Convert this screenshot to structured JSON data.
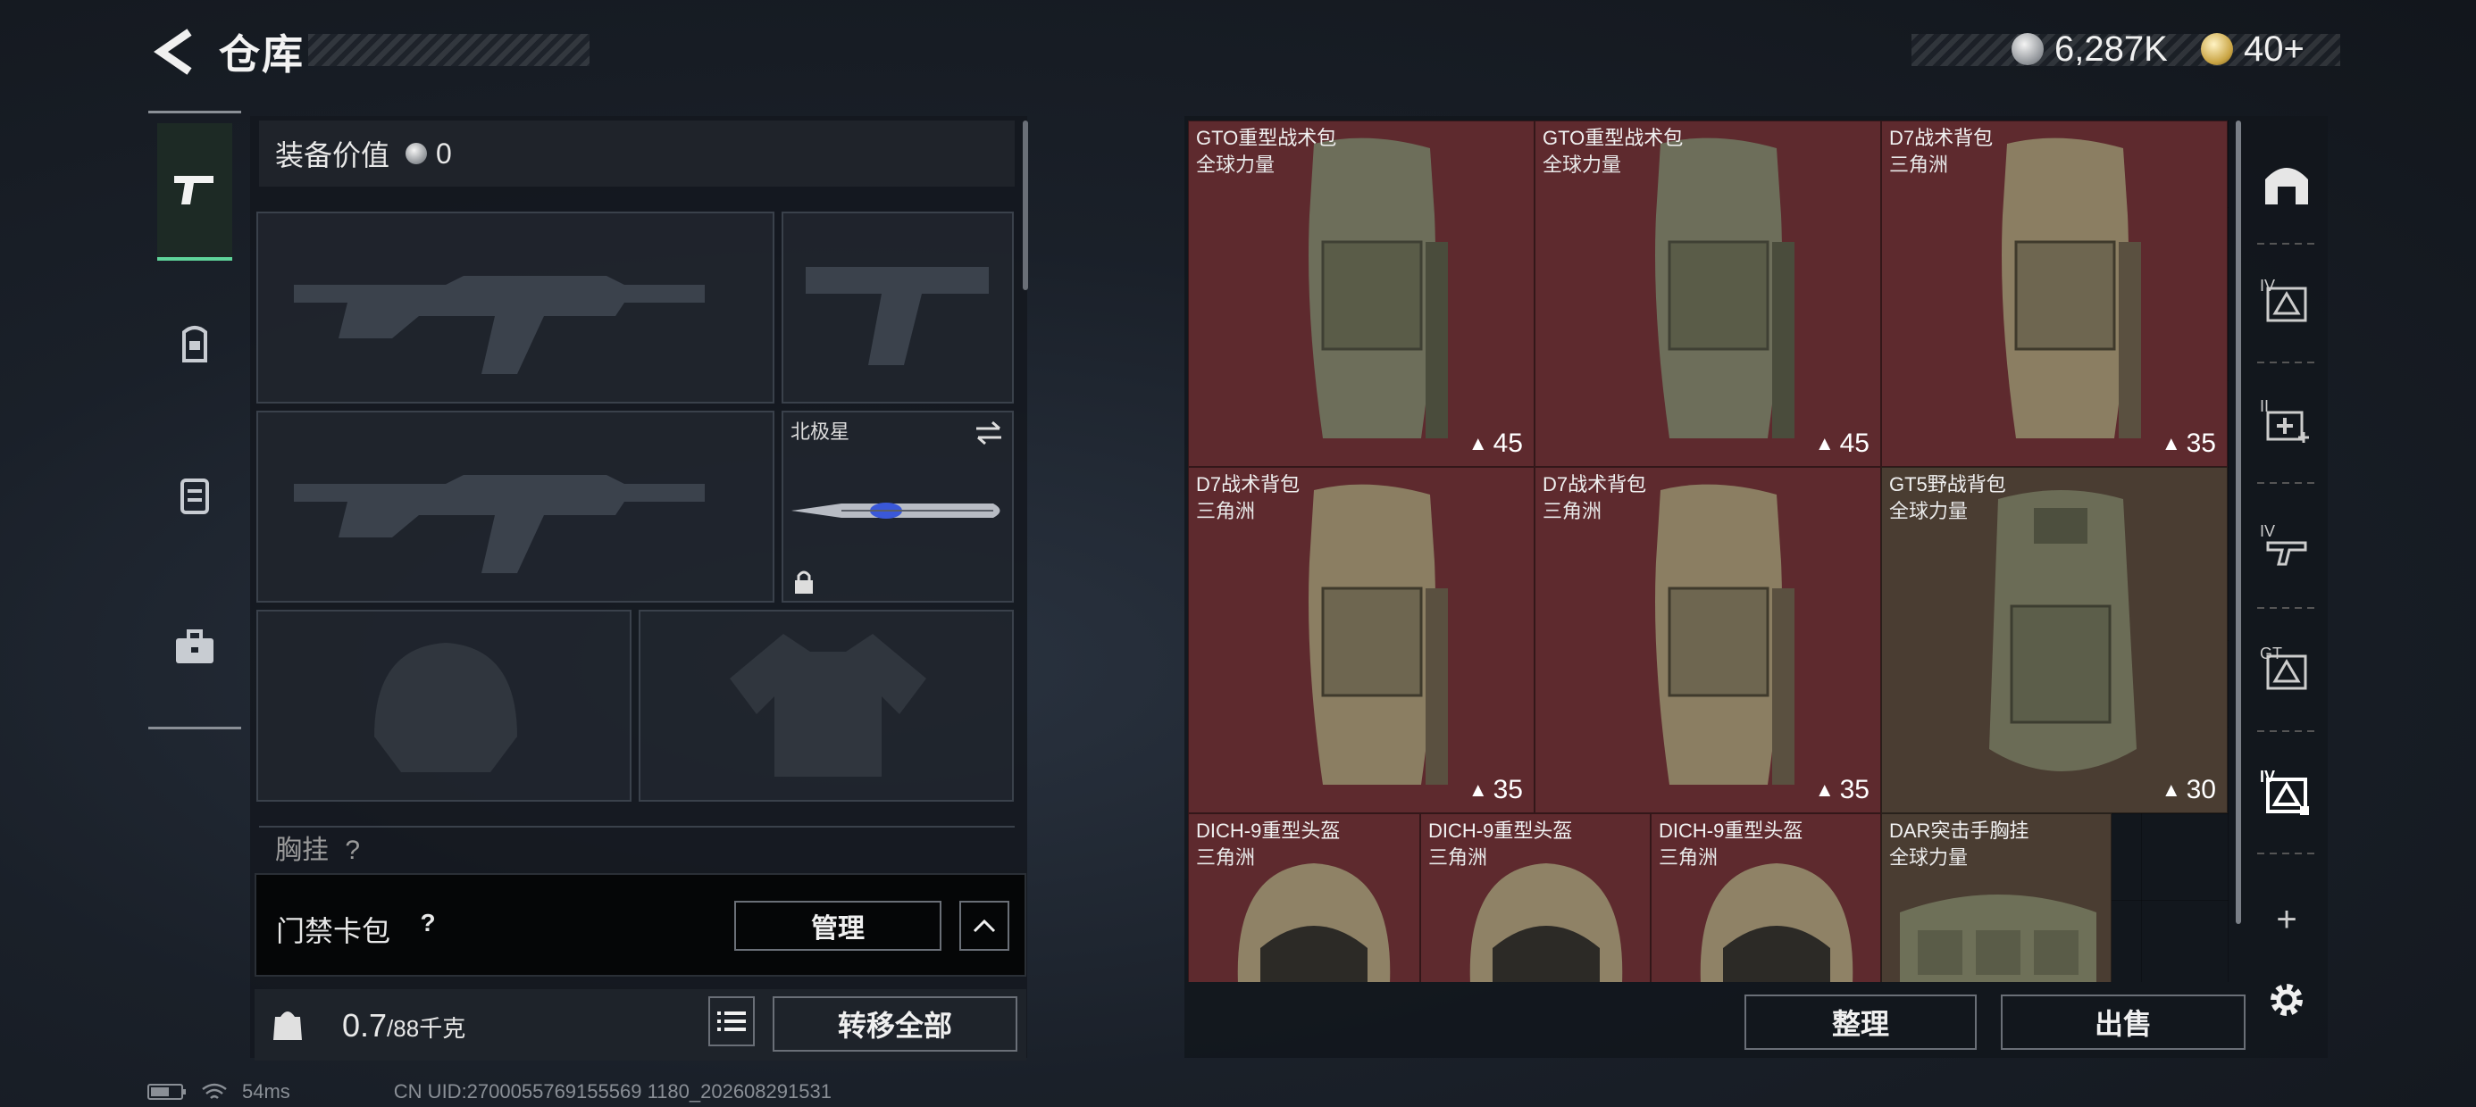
{
  "header": {
    "title": "仓库",
    "silver_amount": "6,287K",
    "gold_amount": "40+"
  },
  "left_panel": {
    "equip_value_label": "装备价值",
    "equip_value": "0",
    "melee_name": "北极星",
    "chest_label": "胸挂",
    "chest_help": "?",
    "keycard_label": "门禁卡包",
    "keycard_help": "?",
    "manage_label": "管理",
    "weight_value": "0.7",
    "weight_max": "/88千克",
    "transfer_all_label": "转移全部",
    "weight_icon_text": "KG"
  },
  "items": [
    {
      "name": "GTO重型战术包",
      "region": "全球力量",
      "capacity": "45"
    },
    {
      "name": "GTO重型战术包",
      "region": "全球力量",
      "capacity": "45"
    },
    {
      "name": "D7战术背包",
      "region": "三角洲",
      "capacity": "35"
    },
    {
      "name": "D7战术背包",
      "region": "三角洲",
      "capacity": "35"
    },
    {
      "name": "D7战术背包",
      "region": "三角洲",
      "capacity": "35"
    },
    {
      "name": "GT5野战背包",
      "region": "全球力量",
      "capacity": "30"
    },
    {
      "name": "DICH-9重型头盔",
      "region": "三角洲"
    },
    {
      "name": "DICH-9重型头盔",
      "region": "三角洲"
    },
    {
      "name": "DICH-9重型头盔",
      "region": "三角洲"
    },
    {
      "name": "DAR突击手胸挂",
      "region": "全球力量"
    }
  ],
  "actions": {
    "sort_label": "整理",
    "sell_label": "出售"
  },
  "side_tabs": {
    "t1": "IV",
    "t2": "II",
    "t3": "IV",
    "t4": "GT",
    "t5": "IV",
    "add": "+"
  },
  "status": {
    "ping": "54ms",
    "uid": "CN UID:2700055769155569 1180_202608291531"
  },
  "colors": {
    "accent_green": "#5fd49a",
    "cell_red": "#5e2a2e",
    "cell_olive": "#4a3d32"
  }
}
